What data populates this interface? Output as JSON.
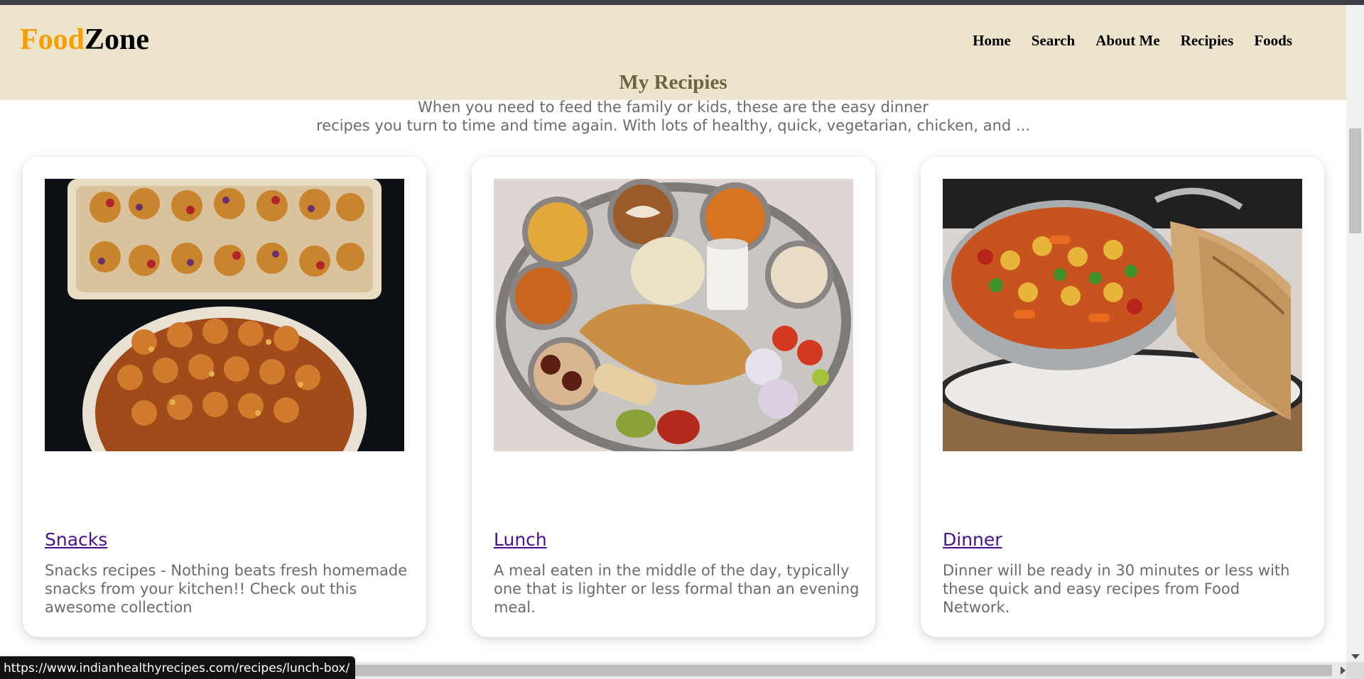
{
  "brand": {
    "part1": "Food",
    "part2": "Zone"
  },
  "nav": [
    "Home",
    "Search",
    "About Me",
    "Recipies",
    "Foods"
  ],
  "section": {
    "title": "My Recipies",
    "intro_line1": "When you need to feed the family or kids, these are the easy dinner",
    "intro_line2": "recipes you turn to time and time again. With lots of healthy, quick, vegetarian, chicken, and ..."
  },
  "cards": [
    {
      "title": "Snacks",
      "description": "Snacks recipes - Nothing beats fresh homemade snacks from your kitchen!! Check out this awesome collection"
    },
    {
      "title": "Lunch",
      "description": "A meal eaten in the middle of the day, typically one that is lighter or less formal than an evening meal."
    },
    {
      "title": "Dinner",
      "description": "Dinner will be ready in 30 minutes or less with these quick and easy recipes from Food Network."
    }
  ],
  "status_bar": {
    "url": "https://www.indianhealthyrecipes.com/recipes/lunch-box/"
  },
  "colors": {
    "header_bg": "#ede5cb",
    "brand_accent": "#f5a000",
    "link": "#4b0f8f",
    "title": "#6e6343"
  }
}
